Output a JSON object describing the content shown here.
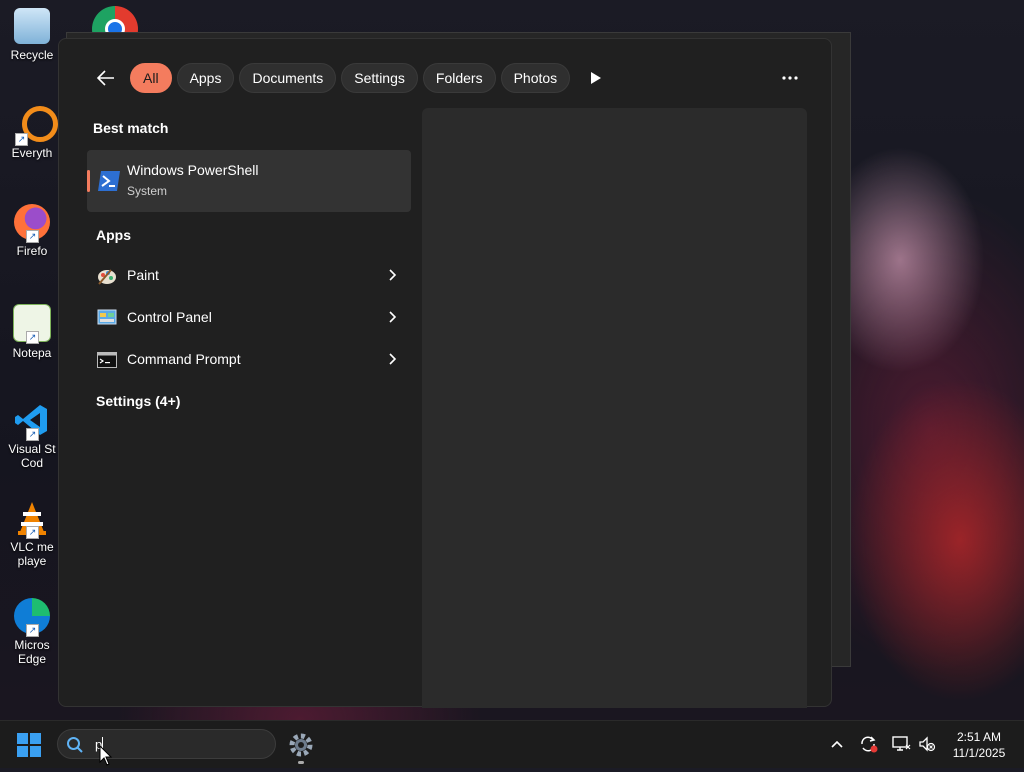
{
  "desktop": {
    "icons": [
      {
        "label": "Recycle",
        "icon": "recycle-bin-icon"
      },
      {
        "label": "Everyth",
        "icon": "everything-search-icon"
      },
      {
        "label": "Firefo",
        "icon": "firefox-icon"
      },
      {
        "label": "Notepa",
        "icon": "notepad-plus-icon"
      },
      {
        "label": "Visual St\nCod",
        "icon": "vscode-icon"
      },
      {
        "label": "VLC me\nplaye",
        "icon": "vlc-icon"
      },
      {
        "label": "Micros\nEdge",
        "icon": "edge-icon"
      }
    ]
  },
  "search_panel": {
    "filters": [
      "All",
      "Apps",
      "Documents",
      "Settings",
      "Folders",
      "Photos"
    ],
    "active_filter": "All",
    "best_match_heading": "Best match",
    "best_match": {
      "title": "Windows PowerShell",
      "subtitle": "System",
      "icon": "powershell-icon"
    },
    "apps_heading": "Apps",
    "apps": [
      {
        "name": "Paint",
        "icon": "paint-icon"
      },
      {
        "name": "Control Panel",
        "icon": "control-panel-icon"
      },
      {
        "name": "Command Prompt",
        "icon": "command-prompt-icon"
      }
    ],
    "settings_heading": "Settings (4+)",
    "accent_color": "#f47c5e"
  },
  "taskbar": {
    "search_value": "p",
    "time": "2:51 AM",
    "date": "11/1/2025"
  }
}
